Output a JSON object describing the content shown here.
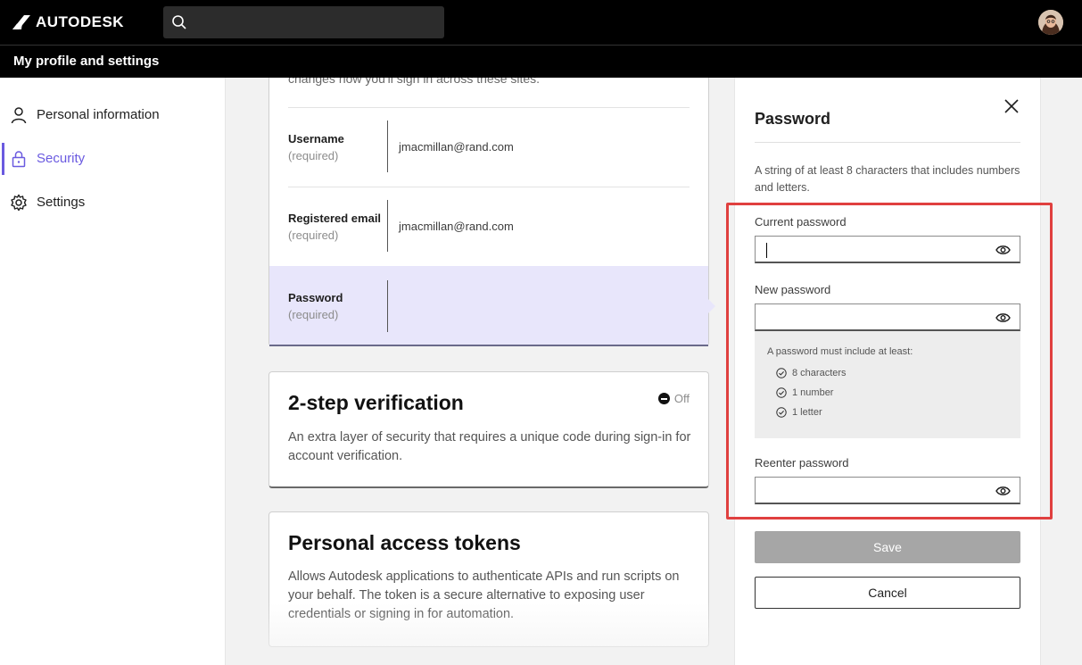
{
  "header": {
    "brand": "AUTODESK",
    "search_placeholder": "",
    "icons": {
      "search": "search-icon",
      "avatar": "user-avatar"
    }
  },
  "subheader": {
    "title": "My profile and settings"
  },
  "sidebar": {
    "items": [
      {
        "label": "Personal information",
        "icon": "person-icon",
        "active": false
      },
      {
        "label": "Security",
        "icon": "lock-icon",
        "active": true
      },
      {
        "label": "Settings",
        "icon": "gear-icon",
        "active": false
      }
    ]
  },
  "main": {
    "cut_text": "changes how you'll sign in across these sites.",
    "fields": [
      {
        "label": "Username",
        "required": "(required)",
        "value": "jmacmillan@rand.com"
      },
      {
        "label": "Registered email",
        "required": "(required)",
        "value": "jmacmillan@rand.com"
      },
      {
        "label": "Password",
        "required": "(required)",
        "value": ""
      }
    ],
    "two_step": {
      "title": "2-step verification",
      "status": "Off",
      "description": "An extra layer of security that requires a unique code during sign-in for account verification."
    },
    "tokens": {
      "title": "Personal access tokens",
      "description": "Allows Autodesk applications to authenticate APIs and run scripts on your behalf. The token is a secure alternative to exposing user credentials or signing in for automation."
    }
  },
  "panel": {
    "title": "Password",
    "description": "A string of at least 8 characters that includes numbers and letters.",
    "current_label": "Current password",
    "new_label": "New password",
    "reenter_label": "Reenter password",
    "rules_title": "A password must include at least:",
    "rules": [
      "8 characters",
      "1 number",
      "1 letter"
    ],
    "save_label": "Save",
    "cancel_label": "Cancel"
  },
  "colors": {
    "accent": "#6a5ae0",
    "highlight": "#e0403f",
    "selected_row": "#e8e6fb"
  }
}
